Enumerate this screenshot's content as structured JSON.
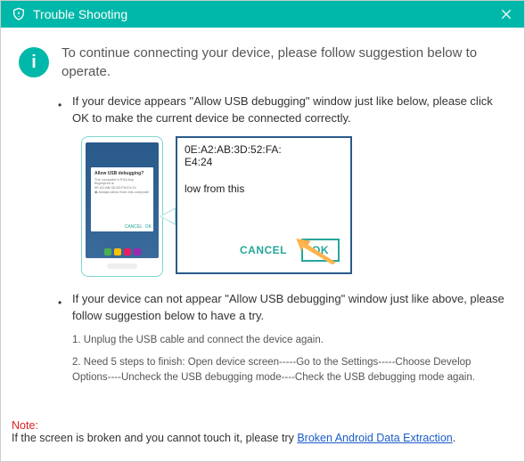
{
  "title": "Trouble Shooting",
  "intro": "To continue connecting your device, please follow suggestion below to operate.",
  "item1": "If your device appears \"Allow USB debugging\" window just like below, please click OK to make the current device  be connected correctly.",
  "modal": {
    "mac_line1": "0E:A2:AB:3D:52:FA:",
    "mac_line2": "E4:24",
    "body": "low from this",
    "cancel": "CANCEL",
    "ok": "OK",
    "phone_title": "Allow USB debugging?"
  },
  "item2": "If your device can not appear \"Allow USB debugging\" window just like above, please follow suggestion below to have a try.",
  "step1": "1. Unplug the USB cable and connect the device again.",
  "step2": "2. Need 5 steps to finish: Open device screen-----Go to the Settings-----Choose Develop Options----Uncheck the USB debugging mode----Check the USB debugging mode again.",
  "note_label": "Note:",
  "note_text": "If the screen is broken and you cannot touch it, please try ",
  "note_link": "Broken Android Data Extraction"
}
